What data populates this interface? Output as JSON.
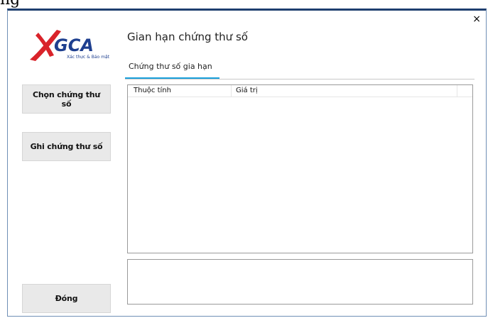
{
  "top_fragment": "ng",
  "window": {
    "title": "Gian hạn chứng thư số",
    "close_glyph": "×"
  },
  "logo": {
    "brand": "GCA",
    "tagline": "Xác thực & Bảo mật",
    "colors": {
      "red": "#d9232a",
      "blue": "#1e3f8f"
    }
  },
  "tabs": [
    {
      "label": "Chứng thư số gia hạn",
      "active": true
    }
  ],
  "sidebar": {
    "select_button": "Chọn chứng thư số",
    "write_button": "Ghi chứng thư số",
    "close_button": "Đóng"
  },
  "grid": {
    "columns": [
      "Thuộc tính",
      "Giá trị"
    ],
    "rows": []
  },
  "detail_text": "",
  "accent_color": "#1aa0db"
}
